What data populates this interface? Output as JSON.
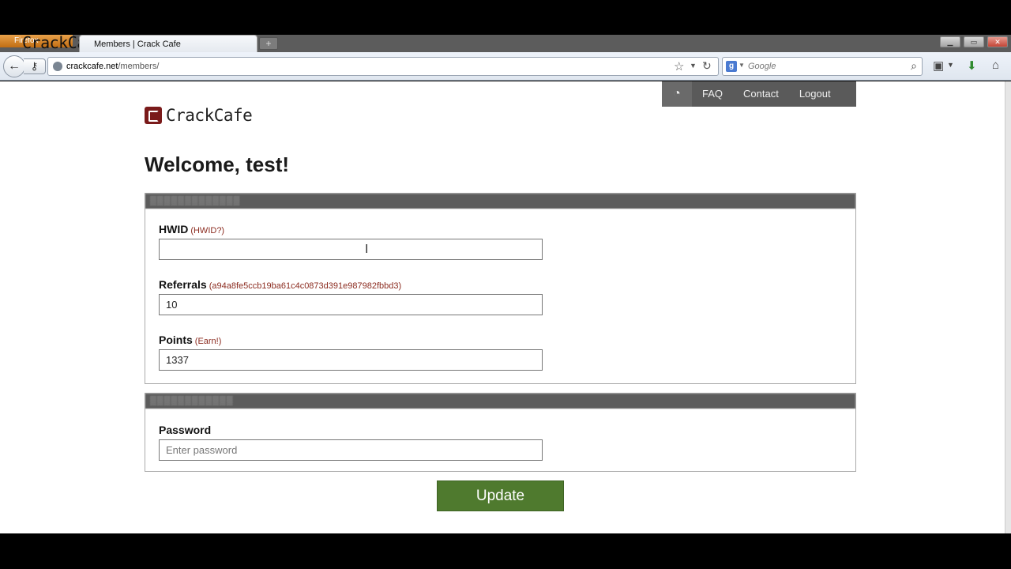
{
  "window": {
    "firefox_button": "Firefox",
    "overlay_title": "CrackCafe",
    "tab_title": "Members | Crack Cafe"
  },
  "navbar": {
    "url_host": "crackcafe.net",
    "url_path": "/members/",
    "search_placeholder": "Google"
  },
  "topnav": {
    "items": [
      "FAQ",
      "Contact",
      "Logout"
    ]
  },
  "brand": {
    "name": "CrackCafe"
  },
  "welcome": "Welcome, test!",
  "account_panel": {
    "fields": [
      {
        "label": "HWID",
        "hint": "(HWID?)",
        "value": ""
      },
      {
        "label": "Referrals",
        "hint": "(a94a8fe5ccb19ba61c4c0873d391e987982fbbd3)",
        "value": "10"
      },
      {
        "label": "Points",
        "hint": "(Earn!)",
        "value": "1337"
      }
    ]
  },
  "password_panel": {
    "label": "Password",
    "placeholder": "Enter password"
  },
  "update_button": "Update",
  "colors": {
    "button_green": "#4f7a2e",
    "hint_red": "#8b2b1f",
    "panel_header": "#5c5c5c",
    "logo_red": "#7a1a1a"
  }
}
